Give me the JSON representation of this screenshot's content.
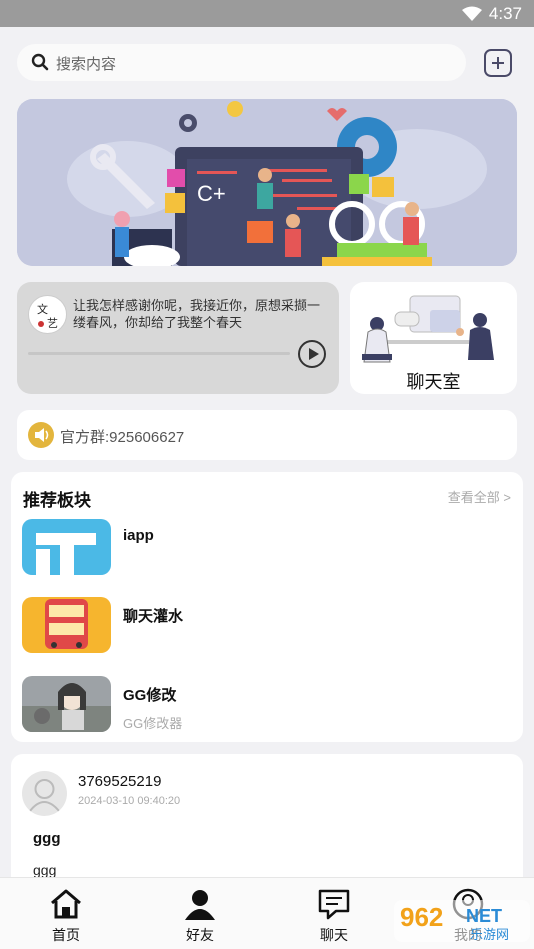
{
  "status": {
    "time": "4:37"
  },
  "search": {
    "placeholder": "搜索内容"
  },
  "player": {
    "lyric": "让我怎样感谢你呢，我接近你，原想采撷一缕春风，你却给了我整个春天",
    "avatar_text": "文艺 这"
  },
  "chatroom": {
    "label": "聊天室"
  },
  "notice": {
    "text": "官方群:925606627"
  },
  "recommend": {
    "title": "推荐板块",
    "more": "查看全部 >",
    "items": [
      {
        "name": "iapp",
        "desc": ""
      },
      {
        "name": "聊天灌水",
        "desc": ""
      },
      {
        "name": "GG修改",
        "desc": "GG修改器"
      }
    ]
  },
  "post": {
    "user": "3769525219",
    "date": "2024-03-10 09:40:20",
    "title": "ggg",
    "body": "ggg"
  },
  "tabs": [
    {
      "label": "首页",
      "icon": "home-icon"
    },
    {
      "label": "好友",
      "icon": "person-icon"
    },
    {
      "label": "聊天",
      "icon": "chat-icon"
    },
    {
      "label": "我的",
      "icon": "profile-icon"
    }
  ],
  "banner": {
    "badge": "C+"
  },
  "watermark": {
    "brand": "962",
    "brand2": "NET",
    "sub": "乐游网"
  },
  "colors": {
    "accent": "#e3b53d",
    "banner_bg": "#c4c8df",
    "statusbar": "#9b9b9b"
  }
}
